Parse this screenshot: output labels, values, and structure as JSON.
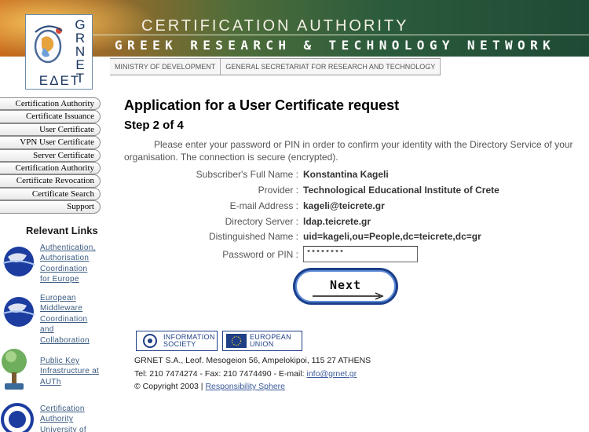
{
  "header": {
    "title": "CERTIFICATION AUTHORITY",
    "subtitle": "GREEK RESEARCH & TECHNOLOGY NETWORK",
    "logo_text": "GRNET",
    "logo_text_greek": "ΕΔΕΤ",
    "nav": [
      "MINISTRY OF DEVELOPMENT",
      "GENERAL SECRETARIAT FOR RESEARCH AND TECHNOLOGY"
    ],
    "banner_colors": [
      "#c86a1c",
      "#2b5b3c"
    ]
  },
  "sidebar": {
    "items": [
      "Certification Authority",
      "Certificate Issuance",
      "User Certificate",
      "VPN User Certificate",
      "Server Certificate",
      "Certification Authority",
      "Certificate Revocation",
      "Certificate Search",
      "Support"
    ],
    "relevant_title": "Relevant Links",
    "relevant_links": [
      {
        "lines": [
          "Authentication,",
          "Authorisation",
          "Coordination",
          "for Europe"
        ],
        "icon": "tf-globe-icon"
      },
      {
        "lines": [
          "European",
          "Middleware",
          "Coordination",
          "and",
          "Collaboration"
        ],
        "icon": "tf-globe-icon"
      },
      {
        "lines": [
          "Public Key",
          "Infrastructure at",
          "AUTh"
        ],
        "icon": "pki-tree-icon"
      },
      {
        "lines": [
          "Certification",
          "Authority",
          "University of"
        ],
        "icon": "ca-globe-icon"
      }
    ]
  },
  "main": {
    "title": "Application for a User Certificate request",
    "step": "Step 2 of 4",
    "instruction": "Please enter your password or PIN in order to confirm your identity with the Directory Service of your organisation. The connection is secure (encrypted).",
    "fields": [
      {
        "label": "Subscriber's Full Name :",
        "value": "Konstantina Kageli"
      },
      {
        "label": "Provider :",
        "value": "Technological Educational Institute of Crete"
      },
      {
        "label": "E-mail Address :",
        "value": "kageli@teicrete.gr"
      },
      {
        "label": "Directory Server :",
        "value": "ldap.teicrete.gr"
      },
      {
        "label": "Distinguished Name :",
        "value": "uid=kageli,ou=People,dc=teicrete,dc=gr"
      }
    ],
    "pin_label": "Password or PIN :",
    "pin_value": "********",
    "next_label": "Next"
  },
  "footer": {
    "badge_info": [
      "INFORMATION",
      "SOCIETY"
    ],
    "badge_eu": [
      "EUROPEAN",
      "UNION"
    ],
    "address": "GRNET S.A., Leof. Mesogeion 56, Ampelokipoi, 115 27 ATHENS",
    "contact_prefix": "Tel: 210 7474274 - Fax: 210 7474490 - E-mail: ",
    "contact_email": "info@grnet.gr",
    "copyright_prefix": "© Copyright 2003 | ",
    "copyright_link": "Responsibility Sphere"
  }
}
